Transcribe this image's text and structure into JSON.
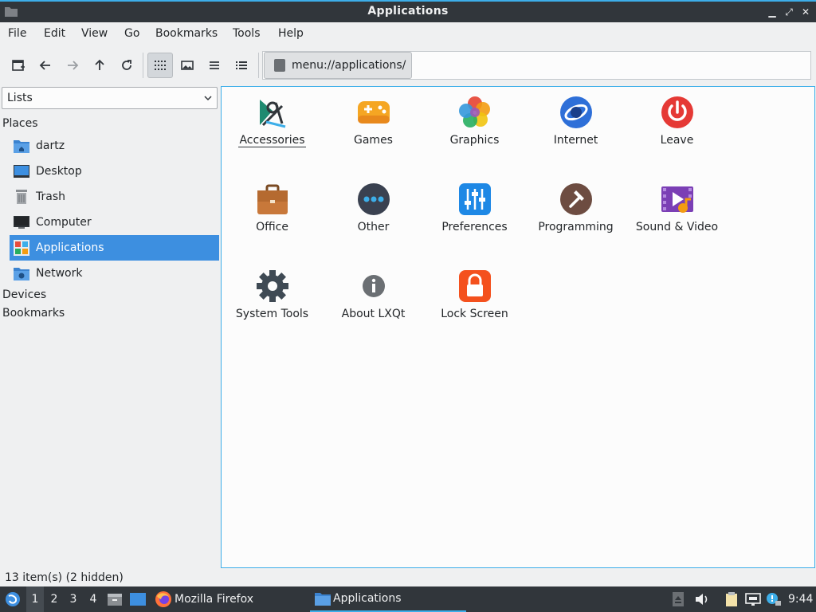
{
  "window": {
    "title": "Applications"
  },
  "menu": {
    "items": [
      "File",
      "Edit",
      "View",
      "Go",
      "Bookmarks",
      "Tools",
      "Help"
    ]
  },
  "toolbar": {
    "path": "menu://applications/"
  },
  "sidebar": {
    "combo_value": "Lists",
    "places_header": "Places",
    "places": [
      {
        "label": "dartz",
        "icon": "home-folder-icon"
      },
      {
        "label": "Desktop",
        "icon": "desktop-icon"
      },
      {
        "label": "Trash",
        "icon": "trash-icon"
      },
      {
        "label": "Computer",
        "icon": "computer-icon"
      },
      {
        "label": "Applications",
        "icon": "applications-icon",
        "selected": true
      },
      {
        "label": "Network",
        "icon": "network-folder-icon"
      }
    ],
    "devices_header": "Devices",
    "bookmarks_header": "Bookmarks"
  },
  "apps": [
    {
      "label": "Accessories",
      "icon": "accessories-icon"
    },
    {
      "label": "Games",
      "icon": "gamepad-icon"
    },
    {
      "label": "Graphics",
      "icon": "graphics-icon"
    },
    {
      "label": "Internet",
      "icon": "globe-icon"
    },
    {
      "label": "Leave",
      "icon": "power-icon"
    },
    {
      "label": "Office",
      "icon": "briefcase-icon"
    },
    {
      "label": "Other",
      "icon": "dots-icon"
    },
    {
      "label": "Preferences",
      "icon": "sliders-icon"
    },
    {
      "label": "Programming",
      "icon": "hammer-icon"
    },
    {
      "label": "Sound & Video",
      "icon": "media-icon"
    },
    {
      "label": "System Tools",
      "icon": "gear-icon"
    },
    {
      "label": "About LXQt",
      "icon": "info-icon"
    },
    {
      "label": "Lock Screen",
      "icon": "lock-icon"
    }
  ],
  "status": {
    "text": "13 item(s) (2 hidden)"
  },
  "panel": {
    "desktops": [
      "1",
      "2",
      "3",
      "4"
    ],
    "tasks": [
      "Mozilla Firefox",
      "Applications"
    ],
    "clock": "9:44"
  },
  "colors": {
    "accent": "#3daee9",
    "selection": "#3d8fe0",
    "panel_bg": "#31363b"
  }
}
